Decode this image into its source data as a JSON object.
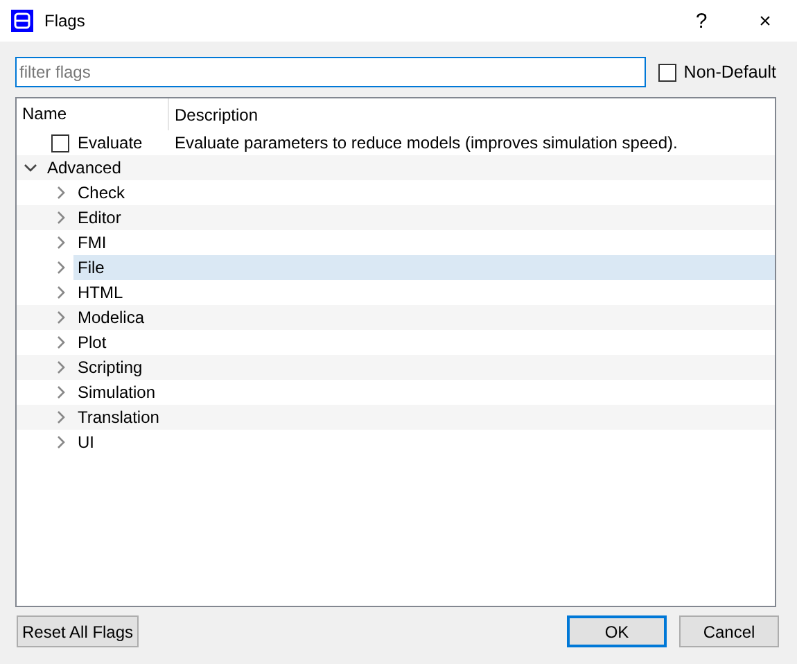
{
  "window": {
    "title": "Flags",
    "buttons": [
      "?",
      "×"
    ]
  },
  "filter": {
    "placeholder": "filter flags"
  },
  "non_default": {
    "label": "Non-Default",
    "checked": false
  },
  "columns": [
    "Name",
    "Description"
  ],
  "tree": [
    {
      "kind": "flag",
      "name": "Evaluate",
      "description": "Evaluate parameters to reduce models (improves simulation speed).",
      "checked": false,
      "selected": false
    },
    {
      "kind": "group",
      "name": "Advanced",
      "expanded": true,
      "selected": false,
      "children": [
        {
          "kind": "group",
          "name": "Check",
          "expanded": false,
          "selected": false
        },
        {
          "kind": "group",
          "name": "Editor",
          "expanded": false,
          "selected": false
        },
        {
          "kind": "group",
          "name": "FMI",
          "expanded": false,
          "selected": false
        },
        {
          "kind": "group",
          "name": "File",
          "expanded": false,
          "selected": true
        },
        {
          "kind": "group",
          "name": "HTML",
          "expanded": false,
          "selected": false
        },
        {
          "kind": "group",
          "name": "Modelica",
          "expanded": false,
          "selected": false
        },
        {
          "kind": "group",
          "name": "Plot",
          "expanded": false,
          "selected": false
        },
        {
          "kind": "group",
          "name": "Scripting",
          "expanded": false,
          "selected": false
        },
        {
          "kind": "group",
          "name": "Simulation",
          "expanded": false,
          "selected": false
        },
        {
          "kind": "group",
          "name": "Translation",
          "expanded": false,
          "selected": false
        },
        {
          "kind": "group",
          "name": "UI",
          "expanded": false,
          "selected": false
        }
      ]
    }
  ],
  "footer": {
    "reset": "Reset All Flags",
    "ok": "OK",
    "cancel": "Cancel"
  }
}
